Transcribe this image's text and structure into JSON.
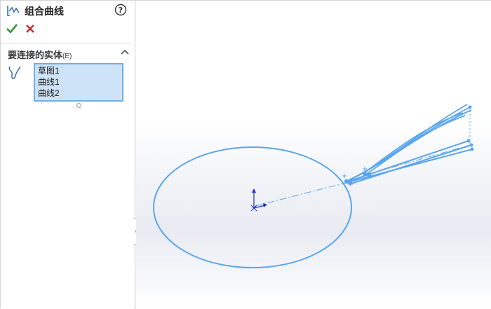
{
  "panel": {
    "title": "组合曲线",
    "title_icon": "composite-curve-icon",
    "help_icon": "help-icon",
    "confirm_icon": "checkmark-icon",
    "cancel_icon": "close-icon",
    "section": {
      "title": "要连接的实体",
      "key_hint": "(E)",
      "collapse_icon": "chevron-up-icon",
      "entity_icon": "curve-entity-icon",
      "items": [
        "草图1",
        "曲线1",
        "曲线2"
      ]
    }
  },
  "colors": {
    "geometry": "#5aa6ee",
    "selection_bg": "#cfe3f8",
    "selection_border": "#6ab0e8",
    "confirm": "#2f9a2f",
    "cancel": "#d0262b",
    "origin": "#1a2fc9"
  }
}
